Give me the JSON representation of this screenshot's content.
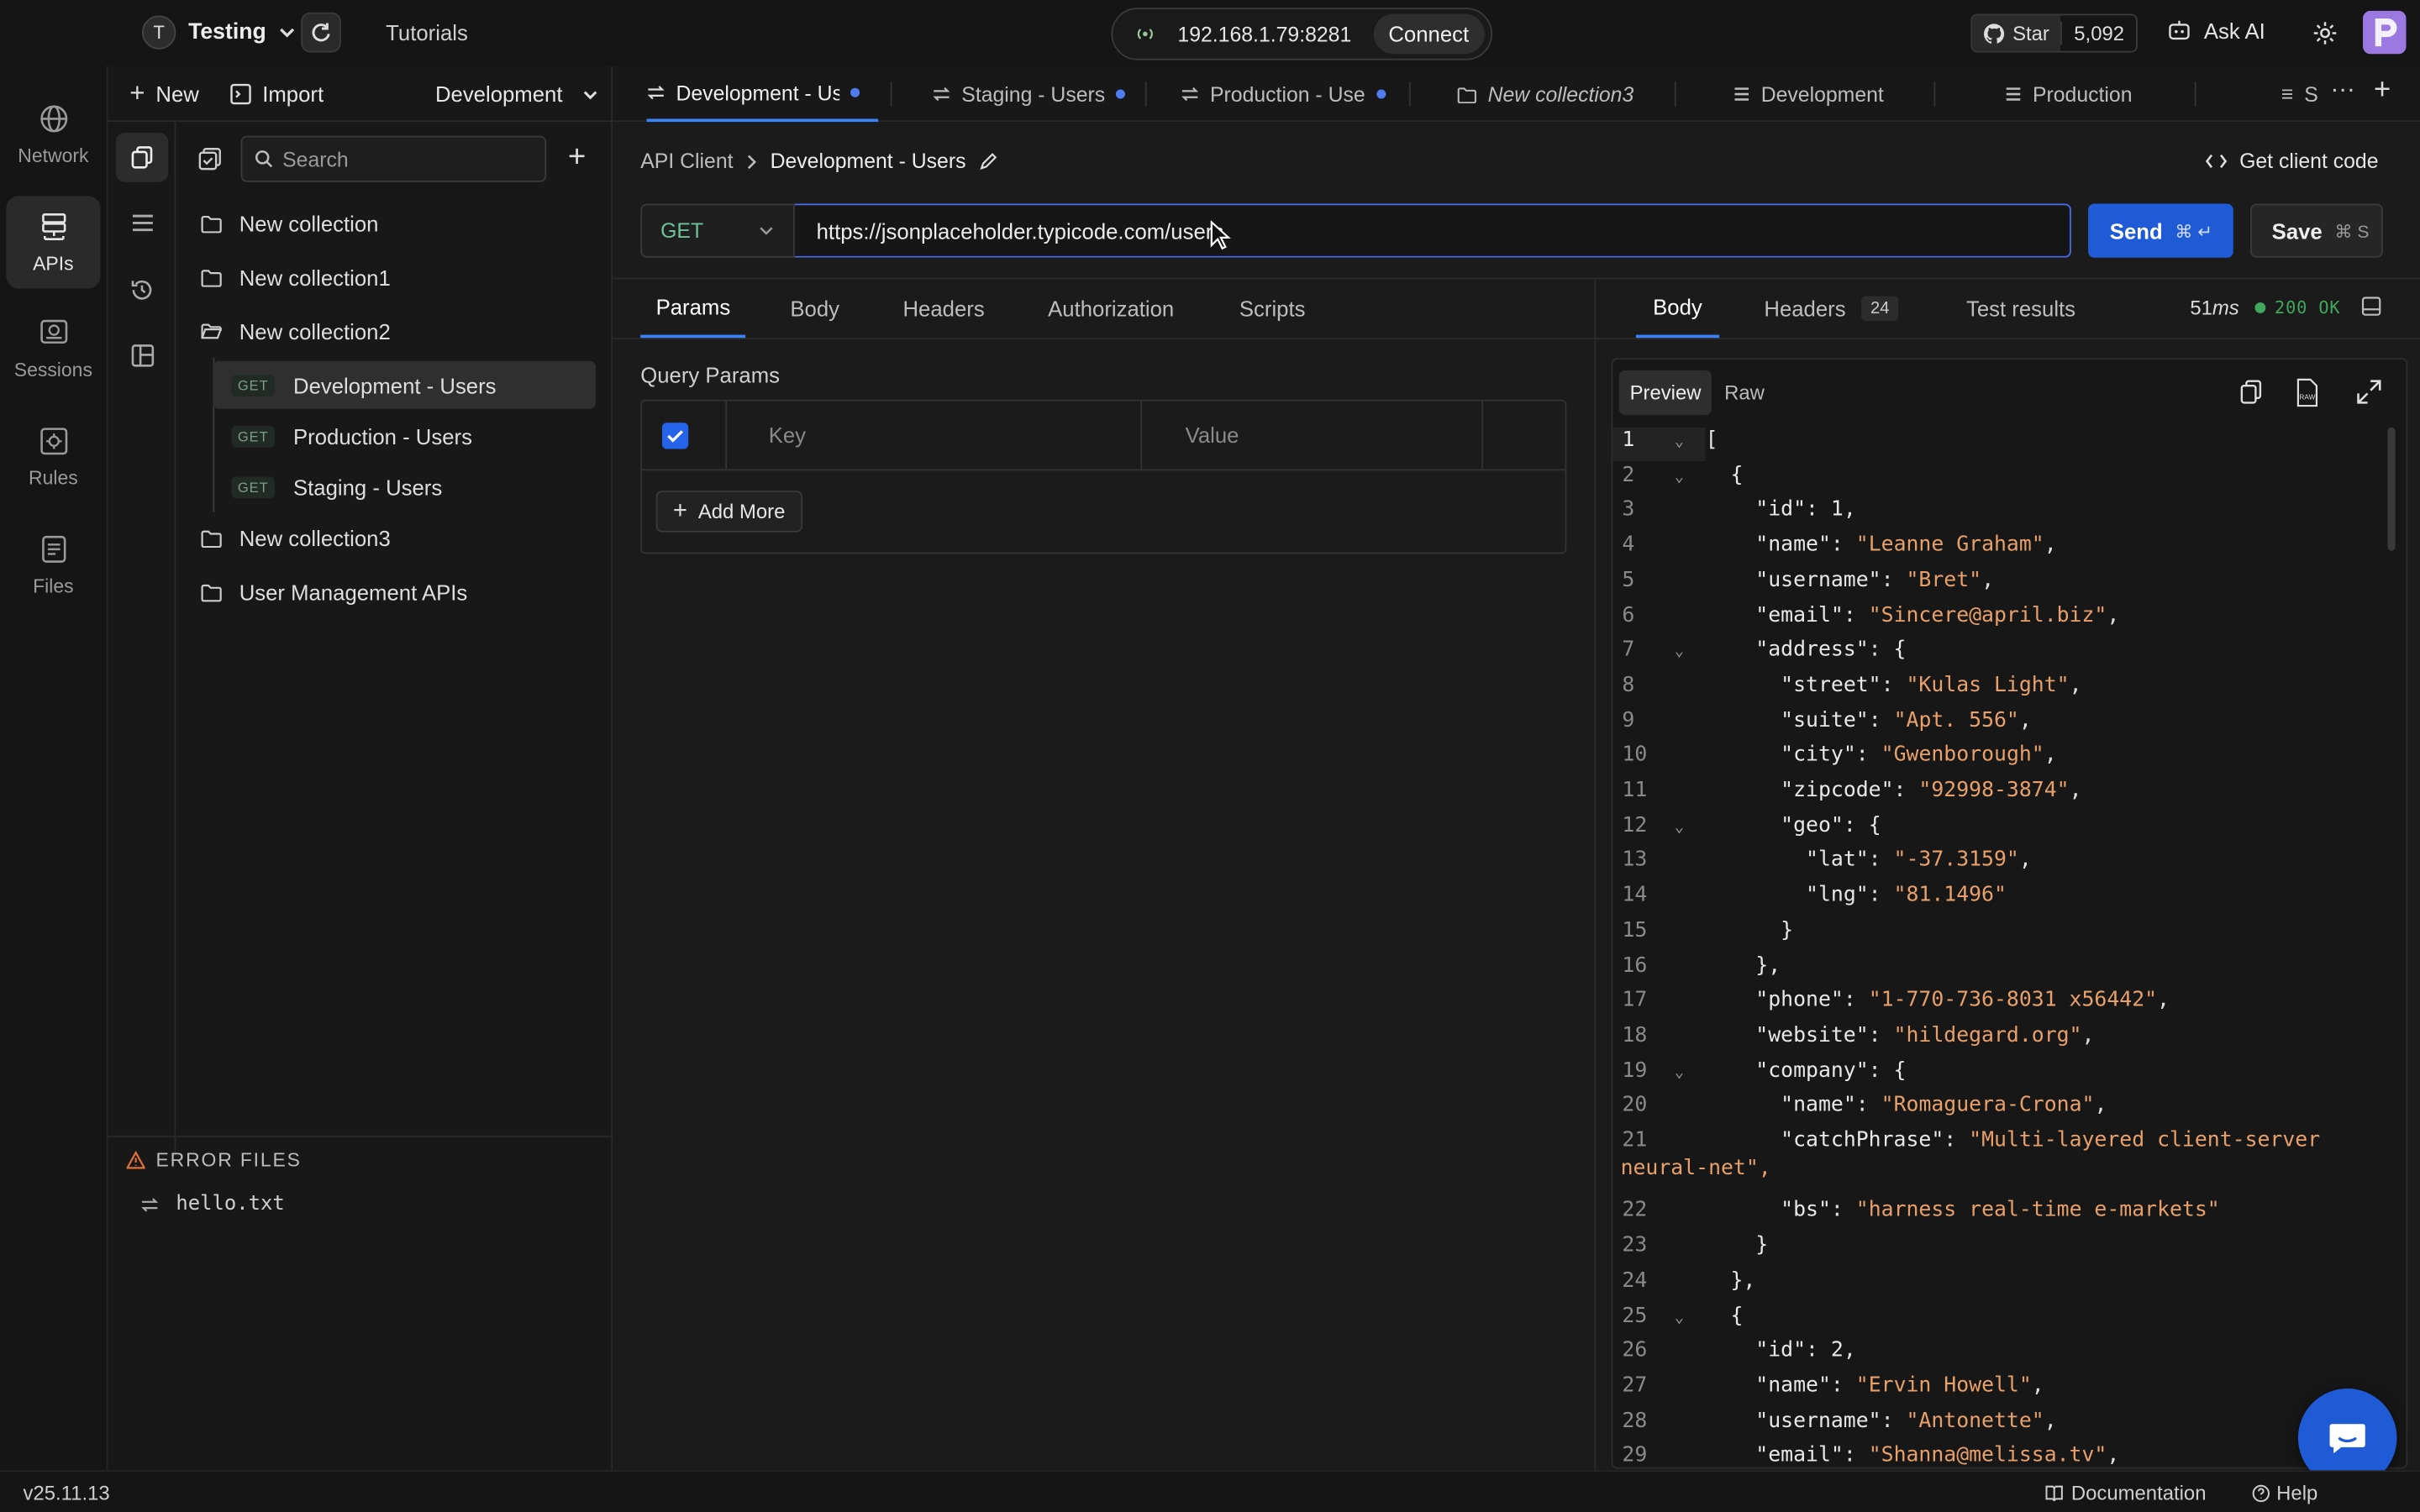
{
  "topbar": {
    "workspace_initial": "T",
    "workspace_name": "Testing",
    "tutorials": "Tutorials",
    "ip_address": "192.168.1.79:8281",
    "connect": "Connect",
    "github_star": "Star",
    "github_count": "5,092",
    "ask_ai": "Ask AI"
  },
  "rail": {
    "items": [
      {
        "label": "Network",
        "icon": "globe-icon"
      },
      {
        "label": "APIs",
        "icon": "api-icon"
      },
      {
        "label": "Sessions",
        "icon": "sessions-icon"
      },
      {
        "label": "Rules",
        "icon": "rules-icon"
      },
      {
        "label": "Files",
        "icon": "files-icon"
      }
    ],
    "version": "v25.11.13"
  },
  "sidebar": {
    "new_label": "New",
    "import_label": "Import",
    "environment": "Development",
    "search_placeholder": "Search",
    "collections": [
      {
        "name": "New collection"
      },
      {
        "name": "New collection1"
      },
      {
        "name": "New collection2",
        "open": true
      },
      {
        "name": "New collection3"
      },
      {
        "name": "User Management APIs"
      }
    ],
    "requests": [
      {
        "method": "GET",
        "name": "Development - Users"
      },
      {
        "method": "GET",
        "name": "Production - Users"
      },
      {
        "method": "GET",
        "name": "Staging - Users"
      }
    ],
    "error_files_title": "ERROR FILES",
    "error_files": [
      "hello.txt"
    ]
  },
  "tabs": [
    {
      "label": "Development - Use",
      "type": "request",
      "dirty": true
    },
    {
      "label": "Staging - Users",
      "type": "request",
      "dirty": true
    },
    {
      "label": "Production - Use",
      "type": "request",
      "dirty": true
    },
    {
      "label": "New collection3",
      "type": "collection"
    },
    {
      "label": "Development",
      "type": "environment"
    },
    {
      "label": "Production",
      "type": "environment"
    },
    {
      "label": "S",
      "type": "environment"
    }
  ],
  "request": {
    "breadcrumb_root": "API Client",
    "breadcrumb_current": "Development - Users",
    "get_client_code": "Get client code",
    "method": "GET",
    "url": "https://jsonplaceholder.typicode.com/users",
    "send": "Send",
    "send_shortcut": "⌘ ↵",
    "save": "Save",
    "save_shortcut": "⌘ S",
    "subtabs": [
      "Params",
      "Body",
      "Headers",
      "Authorization",
      "Scripts"
    ],
    "query_params_title": "Query Params",
    "key_placeholder": "Key",
    "value_placeholder": "Value",
    "add_more": "Add More"
  },
  "response": {
    "tabs": [
      "Body",
      "Headers",
      "Test results"
    ],
    "headers_count": "24",
    "time_value": "51",
    "time_unit": "ms",
    "status": "200 OK",
    "view_modes": [
      "Preview",
      "Raw"
    ],
    "raw_icon_text": "RAW",
    "lines": [
      {
        "n": "1",
        "t": "[",
        "fold": true
      },
      {
        "n": "2",
        "t": "  {",
        "fold": true
      },
      {
        "n": "3",
        "k": "id",
        "v": "1",
        "vt": "num",
        "ind": 4,
        "c": ","
      },
      {
        "n": "4",
        "k": "name",
        "v": "\"Leanne Graham\"",
        "vt": "str",
        "ind": 4,
        "c": ","
      },
      {
        "n": "5",
        "k": "username",
        "v": "\"Bret\"",
        "vt": "str",
        "ind": 4,
        "c": ","
      },
      {
        "n": "6",
        "k": "email",
        "v": "\"Sincere@april.biz\"",
        "vt": "str",
        "ind": 4,
        "c": ","
      },
      {
        "n": "7",
        "k": "address",
        "v": "{",
        "vt": "num",
        "ind": 4,
        "c": "",
        "fold": true
      },
      {
        "n": "8",
        "k": "street",
        "v": "\"Kulas Light\"",
        "vt": "str",
        "ind": 6,
        "c": ","
      },
      {
        "n": "9",
        "k": "suite",
        "v": "\"Apt. 556\"",
        "vt": "str",
        "ind": 6,
        "c": ","
      },
      {
        "n": "10",
        "k": "city",
        "v": "\"Gwenborough\"",
        "vt": "str",
        "ind": 6,
        "c": ","
      },
      {
        "n": "11",
        "k": "zipcode",
        "v": "\"92998-3874\"",
        "vt": "str",
        "ind": 6,
        "c": ","
      },
      {
        "n": "12",
        "k": "geo",
        "v": "{",
        "vt": "num",
        "ind": 6,
        "c": "",
        "fold": true
      },
      {
        "n": "13",
        "k": "lat",
        "v": "\"-37.3159\"",
        "vt": "str",
        "ind": 8,
        "c": ","
      },
      {
        "n": "14",
        "k": "lng",
        "v": "\"81.1496\"",
        "vt": "str",
        "ind": 8,
        "c": ""
      },
      {
        "n": "15",
        "t": "      }"
      },
      {
        "n": "16",
        "t": "    },"
      },
      {
        "n": "17",
        "k": "phone",
        "v": "\"1-770-736-8031 x56442\"",
        "vt": "str",
        "ind": 4,
        "c": ","
      },
      {
        "n": "18",
        "k": "website",
        "v": "\"hildegard.org\"",
        "vt": "str",
        "ind": 4,
        "c": ","
      },
      {
        "n": "19",
        "k": "company",
        "v": "{",
        "vt": "num",
        "ind": 4,
        "c": "",
        "fold": true
      },
      {
        "n": "20",
        "k": "name",
        "v": "\"Romaguera-Crona\"",
        "vt": "str",
        "ind": 6,
        "c": ","
      },
      {
        "n": "21",
        "k": "catchPhrase",
        "v": "\"Multi-layered client-server",
        "vt": "str",
        "ind": 6,
        "c": ""
      },
      {
        "n": "",
        "t": "neural-net\",",
        "tt": "str",
        "wrap": true
      },
      {
        "n": "22",
        "k": "bs",
        "v": "\"harness real-time e-markets\"",
        "vt": "str",
        "ind": 6,
        "c": ""
      },
      {
        "n": "23",
        "t": "    }"
      },
      {
        "n": "24",
        "t": "  },"
      },
      {
        "n": "25",
        "t": "  {",
        "fold": true
      },
      {
        "n": "26",
        "k": "id",
        "v": "2",
        "vt": "num",
        "ind": 4,
        "c": ","
      },
      {
        "n": "27",
        "k": "name",
        "v": "\"Ervin Howell\"",
        "vt": "str",
        "ind": 4,
        "c": ","
      },
      {
        "n": "28",
        "k": "username",
        "v": "\"Antonette\"",
        "vt": "str",
        "ind": 4,
        "c": ","
      },
      {
        "n": "29",
        "k": "email",
        "v": "\"Shanna@melissa.tv\"",
        "vt": "str",
        "ind": 4,
        "c": ","
      }
    ]
  },
  "statusbar": {
    "documentation": "Documentation",
    "help": "Help"
  },
  "colors": {
    "accent": "#1f5bd6",
    "status_ok": "#3fa85a",
    "json_string": "#e8a06a"
  }
}
